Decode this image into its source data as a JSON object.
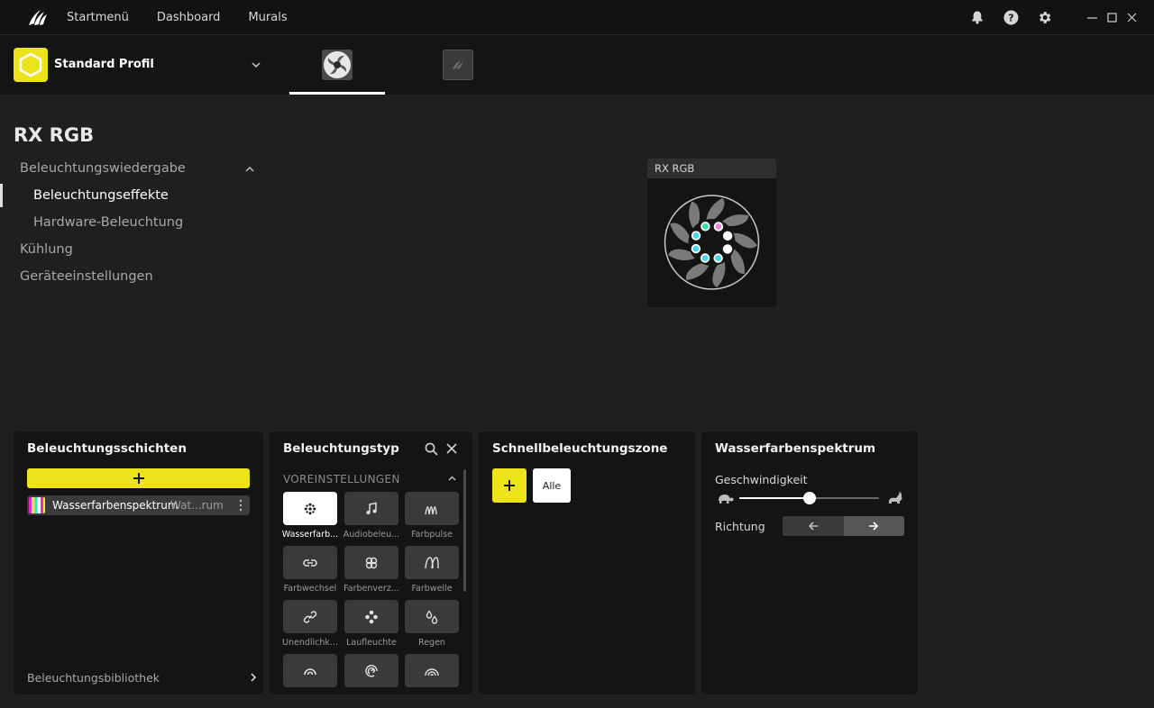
{
  "topnav": {
    "items": [
      "Startmenü",
      "Dashboard",
      "Murals"
    ]
  },
  "titlebar_icons": [
    "bell-icon",
    "help-icon",
    "gear-icon"
  ],
  "window_controls": [
    "minimize-icon",
    "maximize-icon",
    "close-icon"
  ],
  "profile": {
    "name": "Standard Profil"
  },
  "device": {
    "title": "RX RGB",
    "card_title": "RX RGB"
  },
  "left_nav": {
    "section": "Beleuchtungswiedergabe",
    "items": [
      "Beleuchtungseffekte",
      "Hardware-Beleuchtung"
    ],
    "other": [
      "Kühlung",
      "Geräteeinstellungen"
    ]
  },
  "layers_panel": {
    "title": "Beleuchtungsschichten",
    "layer": {
      "name": "Wasserfarbenspektrum",
      "sub": "Wat...rum"
    },
    "library": "Beleuchtungsbibliothek"
  },
  "type_panel": {
    "title": "Beleuchtungstyp",
    "presets_label": "VOREINSTELLUNGEN",
    "tiles": [
      {
        "label": "Wasserfarb...",
        "icon": "watercolor-icon"
      },
      {
        "label": "Audiobeleu...",
        "icon": "music-note-icon"
      },
      {
        "label": "Farbpulse",
        "icon": "pulse-wave-icon"
      },
      {
        "label": "Farbwechsel",
        "icon": "link-icon"
      },
      {
        "label": "Farbenverz...",
        "icon": "shift-icon"
      },
      {
        "label": "Farbwelle",
        "icon": "wave-icon"
      },
      {
        "label": "Unendlichk...",
        "icon": "infinity-icon"
      },
      {
        "label": "Laufleuchte",
        "icon": "marquee-icon"
      },
      {
        "label": "Regen",
        "icon": "rain-icon"
      },
      {
        "label": "",
        "icon": "arc-icon"
      },
      {
        "label": "",
        "icon": "spiral-icon"
      },
      {
        "label": "",
        "icon": "rainbow-icon"
      }
    ]
  },
  "quick_zone_panel": {
    "title": "Schnellbeleuchtungszone",
    "all_label": "Alle"
  },
  "effect_panel": {
    "title": "Wasserfarbenspektrum",
    "speed_label": "Geschwindigkeit",
    "speed_value": 0.5,
    "direction_label": "Richtung",
    "direction_selected": "right"
  },
  "colors": {
    "accent": "#ece31a",
    "background": "#1f1f1f",
    "panel": "#141414"
  }
}
